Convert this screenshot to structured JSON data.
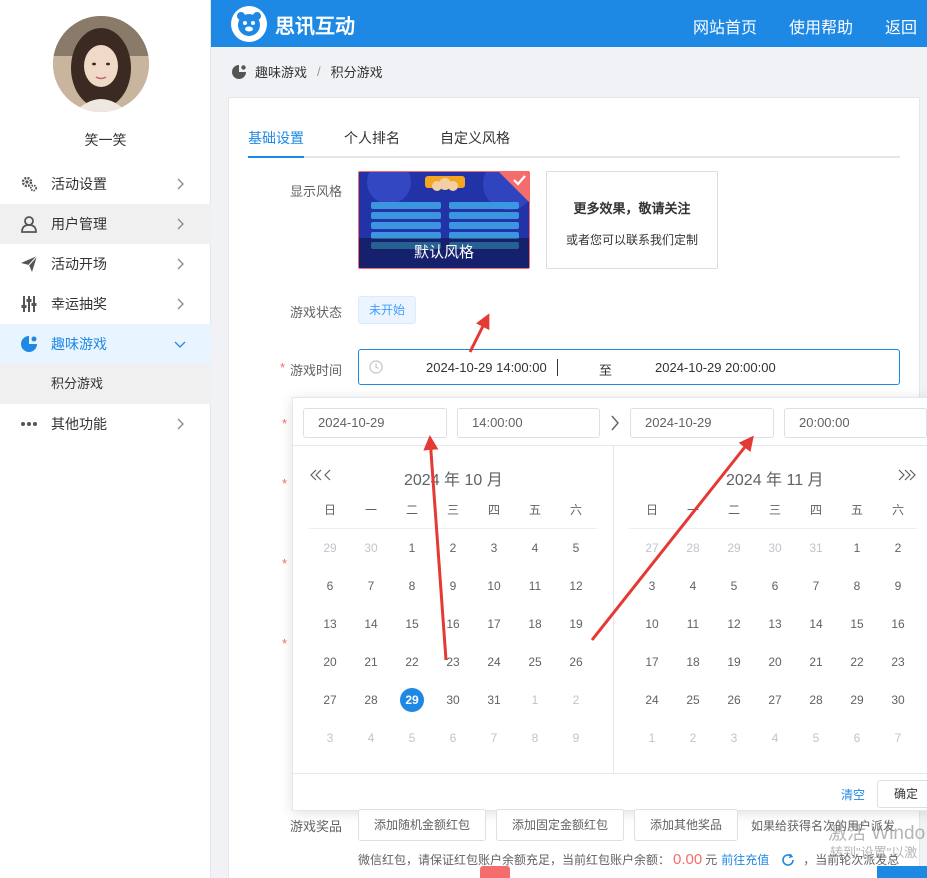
{
  "sidebar": {
    "username": "笑一笑",
    "items": [
      {
        "label": "活动设置",
        "icon": "gear-icon"
      },
      {
        "label": "用户管理",
        "icon": "user-icon"
      },
      {
        "label": "活动开场",
        "icon": "paper-plane-icon"
      },
      {
        "label": "幸运抽奖",
        "icon": "slider-icon"
      },
      {
        "label": "趣味游戏",
        "icon": "game-icon"
      },
      {
        "label": "其他功能",
        "icon": "ellipsis-icon"
      }
    ],
    "submenu": [
      "积分游戏"
    ]
  },
  "header": {
    "title": "思讯互动",
    "nav": [
      "网站首页",
      "使用帮助",
      "返回"
    ],
    "color": "#1e88e5"
  },
  "breadcrumb": [
    "趣味游戏",
    "积分游戏"
  ],
  "tabs": [
    "基础设置",
    "个人排名",
    "自定义风格"
  ],
  "form": {
    "style_label": "显示风格",
    "style_default": "默认风格",
    "more_title": "更多效果，敬请关注",
    "more_sub": "或者您可以联系我们定制",
    "status_label": "游戏状态",
    "status_value": "未开始",
    "time_label": "游戏时间",
    "start": "2024-10-29 14:00:00",
    "to": "至",
    "end": "2024-10-29 20:00:00",
    "prize_label": "游戏奖品",
    "prize_buttons": [
      "添加随机金额红包",
      "添加固定金额红包",
      "添加其他奖品"
    ],
    "prize_note": "如果给获得名次的用户派发",
    "notice_text": "微信红包，请保证红包账户余额充足，当前红包账户余额：",
    "notice_amount": "0.00",
    "notice_unit": "元",
    "notice_link": "前往充值",
    "notice_tail": "，当前轮次派发总"
  },
  "picker": {
    "start_date": "2024-10-29",
    "start_time": "14:00:00",
    "end_date": "2024-10-29",
    "end_time": "20:00:00",
    "left_title": "2024 年 10 月",
    "right_title": "2024 年 11 月",
    "weekdays": [
      "日",
      "一",
      "二",
      "三",
      "四",
      "五",
      "六"
    ],
    "left_days": [
      [
        "29",
        "30",
        "1",
        "2",
        "3",
        "4",
        "5"
      ],
      [
        "6",
        "7",
        "8",
        "9",
        "10",
        "11",
        "12"
      ],
      [
        "13",
        "14",
        "15",
        "16",
        "17",
        "18",
        "19"
      ],
      [
        "20",
        "21",
        "22",
        "23",
        "24",
        "25",
        "26"
      ],
      [
        "27",
        "28",
        "29",
        "30",
        "31",
        "1",
        "2"
      ],
      [
        "3",
        "4",
        "5",
        "6",
        "7",
        "8",
        "9"
      ]
    ],
    "right_days": [
      [
        "27",
        "28",
        "29",
        "30",
        "31",
        "1",
        "2"
      ],
      [
        "3",
        "4",
        "5",
        "6",
        "7",
        "8",
        "9"
      ],
      [
        "10",
        "11",
        "12",
        "13",
        "14",
        "15",
        "16"
      ],
      [
        "17",
        "18",
        "19",
        "20",
        "21",
        "22",
        "23"
      ],
      [
        "24",
        "25",
        "26",
        "27",
        "28",
        "29",
        "30"
      ],
      [
        "1",
        "2",
        "3",
        "4",
        "5",
        "6",
        "7"
      ]
    ],
    "clear_label": "清空",
    "ok_label": "确定"
  },
  "watermark": {
    "line1": "激活 Windo",
    "line2": "转到\"设置\"以激"
  },
  "annotation_color": "#e53935"
}
